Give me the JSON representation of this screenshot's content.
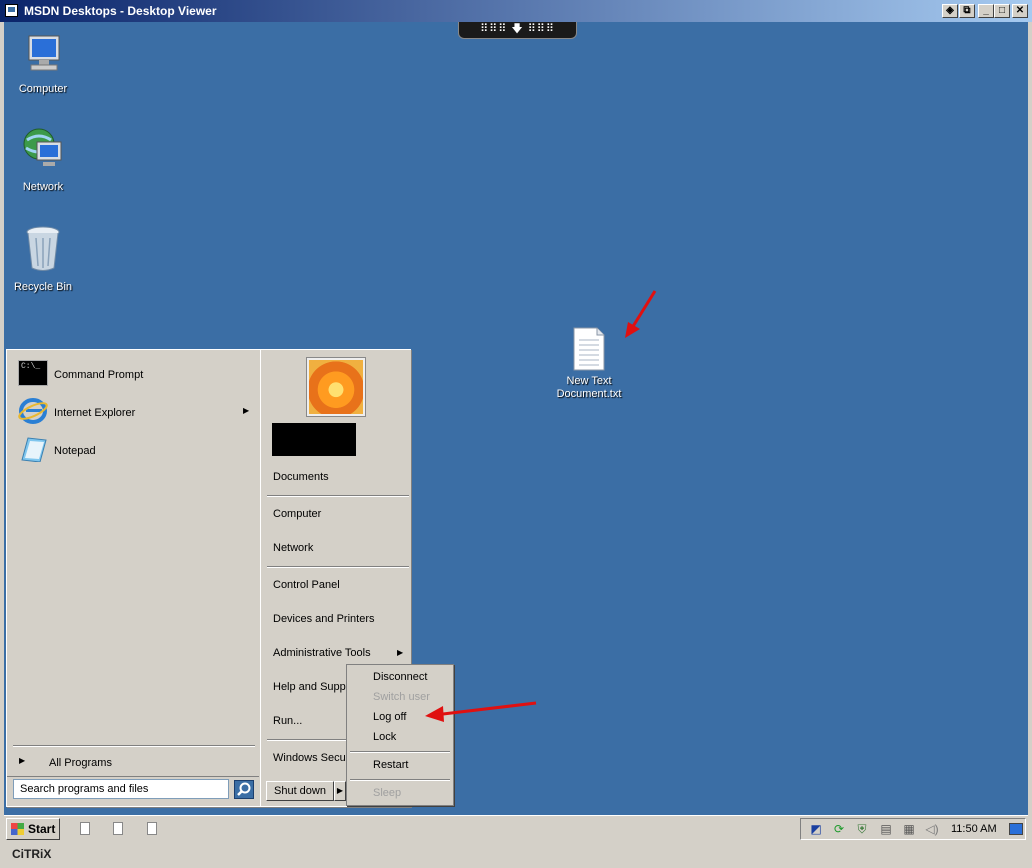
{
  "window": {
    "title": "MSDN Desktops - Desktop Viewer",
    "controls": [
      "◈",
      "⧉",
      "_",
      "□",
      "✕"
    ]
  },
  "toolbar_handle": "⠿⠿⠿ 🡇 ⠿⠿⠿",
  "desktop_icons": [
    {
      "label": "Computer",
      "icon": "computer-icon"
    },
    {
      "label": "Network",
      "icon": "network-icon"
    },
    {
      "label": "Recycle Bin",
      "icon": "recycle-bin-icon"
    },
    {
      "label_line1": "New Text",
      "label_line2": "Document.txt",
      "icon": "text-document-icon"
    }
  ],
  "start_menu": {
    "pinned": [
      {
        "label": "Command Prompt",
        "icon": "command-prompt-icon"
      },
      {
        "label": "Internet Explorer",
        "icon": "internet-explorer-icon"
      },
      {
        "label": "Notepad",
        "icon": "notepad-icon"
      }
    ],
    "all_programs": "All Programs",
    "search_placeholder": "Search programs and files",
    "right": {
      "documents": "Documents",
      "computer": "Computer",
      "network": "Network",
      "control_panel": "Control Panel",
      "devices_printers": "Devices and Printers",
      "admin_tools": "Administrative Tools",
      "help_support": "Help and Support",
      "run": "Run...",
      "windows_security": "Windows Security"
    },
    "shutdown_label": "Shut down"
  },
  "shutdown_flyout": [
    {
      "label": "Disconnect",
      "enabled": true
    },
    {
      "label": "Switch user",
      "enabled": false
    },
    {
      "label": "Log off",
      "enabled": true
    },
    {
      "label": "Lock",
      "enabled": true
    },
    {
      "label": "Restart",
      "enabled": true
    },
    {
      "label": "Sleep",
      "enabled": false
    }
  ],
  "taskbar": {
    "start_label": "Start",
    "clock": "11:50 AM"
  },
  "footer_brand": "CiTRiX",
  "colors": {
    "desktop": "#3b6ea5",
    "annotation_arrow": "#e01010"
  }
}
